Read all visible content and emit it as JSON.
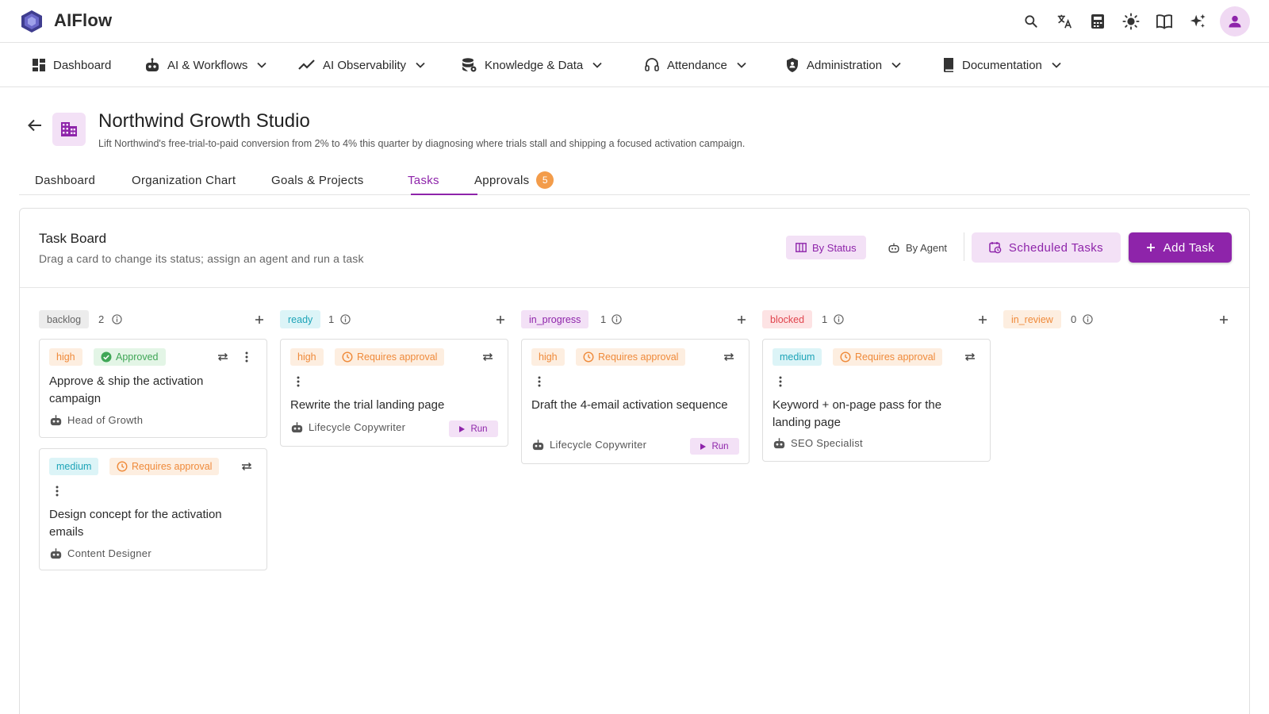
{
  "app": {
    "title": "AIFlow"
  },
  "nav": [
    {
      "label": "Dashboard"
    },
    {
      "label": "AI & Workflows"
    },
    {
      "label": "AI Observability"
    },
    {
      "label": "Knowledge & Data"
    },
    {
      "label": "Attendance"
    },
    {
      "label": "Administration"
    },
    {
      "label": "Documentation"
    }
  ],
  "org": {
    "title": "Northwind Growth Studio",
    "description": "Lift Northwind's free-trial-to-paid conversion from 2% to 4% this quarter by diagnosing where trials stall and shipping a focused activation campaign."
  },
  "tabs": [
    {
      "label": "Dashboard"
    },
    {
      "label": "Organization Chart"
    },
    {
      "label": "Goals & Projects"
    },
    {
      "label": "Tasks"
    },
    {
      "label": "Approvals",
      "badge": "5"
    }
  ],
  "board": {
    "title": "Task Board",
    "subtitle": "Drag a card to change its status; assign an agent and run a task",
    "by_status": "By Status",
    "by_agent": "By Agent",
    "scheduled": "Scheduled Tasks",
    "add_task": "Add Task"
  },
  "columns": [
    {
      "status": "backlog",
      "count": "2",
      "cards": [
        {
          "priority": "high",
          "approval": "Approved",
          "title": "Approve & ship the activation campaign",
          "agent": "Head of Growth"
        },
        {
          "priority": "medium",
          "approval": "Requires approval",
          "title": "Design concept for the activation emails",
          "agent": "Content Designer"
        }
      ]
    },
    {
      "status": "ready",
      "count": "1",
      "cards": [
        {
          "priority": "high",
          "approval": "Requires approval",
          "title": "Rewrite the trial landing page",
          "agent": "Lifecycle Copywriter",
          "run": "Run"
        }
      ]
    },
    {
      "status": "in_progress",
      "count": "1",
      "cards": [
        {
          "priority": "high",
          "approval": "Requires approval",
          "title": "Draft the 4-email activation sequence",
          "agent": "Lifecycle Copywriter",
          "run": "Run"
        }
      ]
    },
    {
      "status": "blocked",
      "count": "1",
      "cards": [
        {
          "priority": "medium",
          "approval": "Requires approval",
          "title": "Keyword + on-page pass for the landing page",
          "agent": "SEO Specialist"
        }
      ]
    },
    {
      "status": "in_review",
      "count": "0",
      "cards": []
    }
  ],
  "colors": {
    "accent": "#8e24aa",
    "accent_light": "#f3e1f6",
    "badge": "#f39c4a"
  },
  "icons": [
    "search-icon",
    "translate-icon",
    "calculator-icon",
    "sun-icon",
    "book-open-icon",
    "sparkle-icon",
    "user-icon"
  ]
}
